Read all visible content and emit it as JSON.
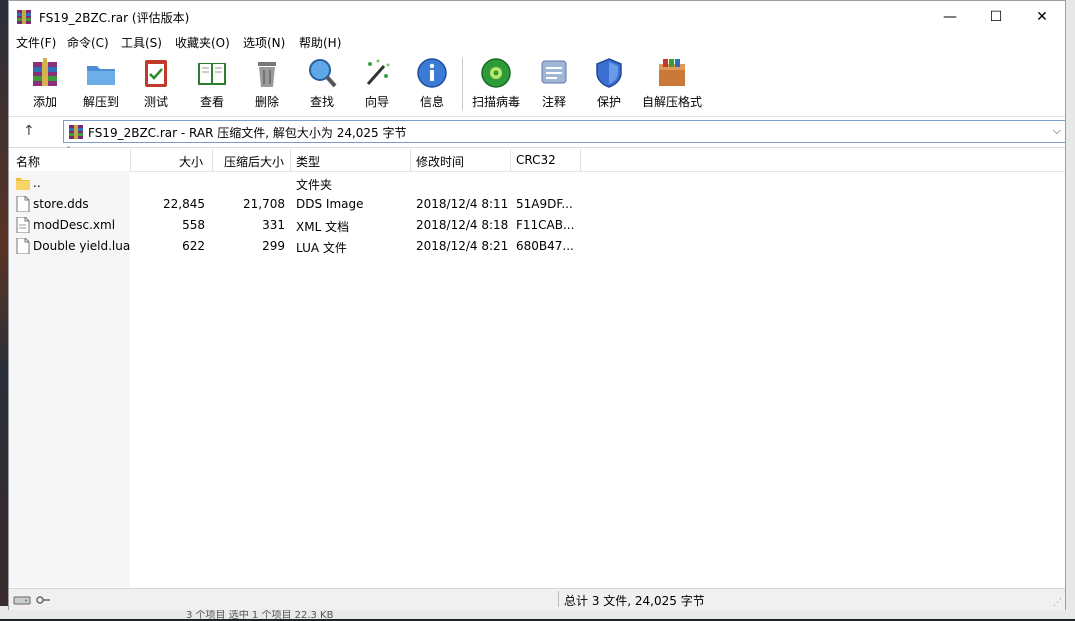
{
  "window": {
    "title": "FS19_2BZC.rar (评估版本)",
    "controls": {
      "minimize": "—",
      "maximize": "☐",
      "close": "✕"
    }
  },
  "menu": [
    "文件(F)",
    "命令(C)",
    "工具(S)",
    "收藏夹(O)",
    "选项(N)",
    "帮助(H)"
  ],
  "toolbar": {
    "add": "添加",
    "extract": "解压到",
    "test": "测试",
    "view": "查看",
    "delete": "删除",
    "find": "查找",
    "wizard": "向导",
    "info": "信息",
    "virus_scan": "扫描病毒",
    "comment": "注释",
    "protect": "保护",
    "sfx": "自解压格式"
  },
  "address": {
    "up": "↑",
    "text": "FS19_2BZC.rar - RAR 压缩文件, 解包大小为 24,025 字节",
    "dropdown": "⌵"
  },
  "columns": {
    "name": "名称",
    "size": "大小",
    "packed": "压缩后大小",
    "type": "类型",
    "modified": "修改时间",
    "crc": "CRC32",
    "sort_indicator": "ˇ"
  },
  "files": [
    {
      "name": "..",
      "size": "",
      "packed": "",
      "type": "文件夹",
      "modified": "",
      "crc": "",
      "icon": "folder-icon"
    },
    {
      "name": "store.dds",
      "size": "22,845",
      "packed": "21,708",
      "type": "DDS Image",
      "modified": "2018/12/4 8:11",
      "crc": "51A9DF...",
      "icon": "file-icon"
    },
    {
      "name": "modDesc.xml",
      "size": "558",
      "packed": "331",
      "type": "XML 文档",
      "modified": "2018/12/4 8:18",
      "crc": "F11CAB...",
      "icon": "xml-file-icon"
    },
    {
      "name": "Double yield.lua",
      "size": "622",
      "packed": "299",
      "type": "LUA 文件",
      "modified": "2018/12/4 8:21",
      "crc": "680B47...",
      "icon": "file-icon"
    }
  ],
  "status": {
    "summary": "总计 3 文件, 24,025 字节"
  },
  "background": {
    "taskbar_text": "3 个项目    选中 1 个项目 22.3 KB"
  },
  "colors": {
    "address_border": "#7a9cc6",
    "name_column_bg": "#f6f6f6"
  }
}
